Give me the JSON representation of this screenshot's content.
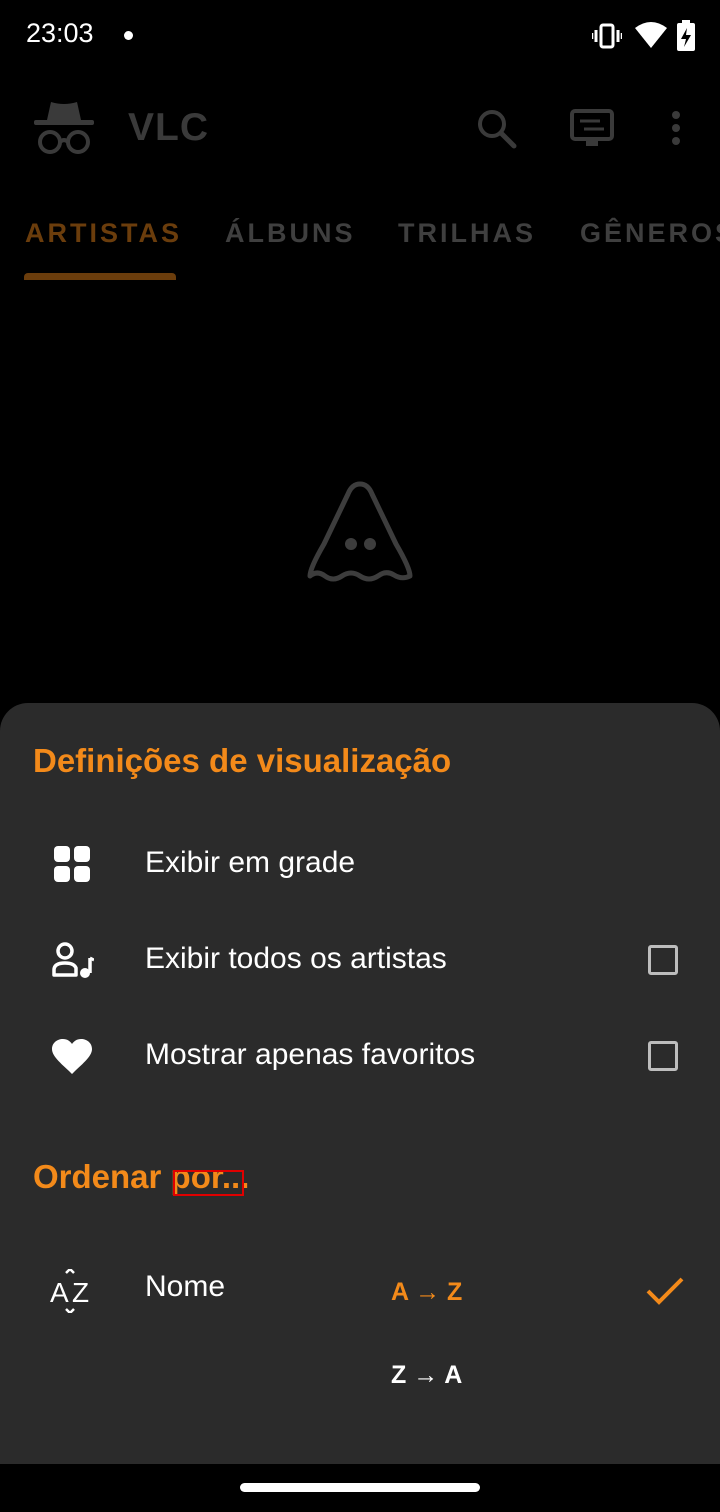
{
  "status_bar": {
    "time": "23:03",
    "icons": [
      "vibrate-icon",
      "wifi-icon",
      "battery-charging-icon"
    ]
  },
  "app_bar": {
    "title": "VLC",
    "icons": [
      "incognito-icon",
      "search-icon",
      "cast-icon",
      "more-vert-icon"
    ]
  },
  "tabs": [
    {
      "label": "ARTISTAS",
      "selected": true
    },
    {
      "label": "ÁLBUNS",
      "selected": false
    },
    {
      "label": "TRILHAS",
      "selected": false
    },
    {
      "label": "GÊNEROS",
      "selected": false
    }
  ],
  "empty_state": {
    "icon": "vlc-cone-icon"
  },
  "sheet": {
    "view_title": "Definições de visualização",
    "view_items": [
      {
        "label": "Exibir em grade",
        "icon": "grid-icon"
      },
      {
        "label": "Exibir todos os artistas",
        "icon": "artist-music-icon",
        "checked": false
      },
      {
        "label": "Mostrar apenas favoritos",
        "icon": "heart-icon",
        "checked": false
      }
    ],
    "sort_title": "Ordenar por...",
    "sort_items": [
      {
        "label": "Nome",
        "icon": "sort-alpha-icon",
        "asc_label": "A → Z",
        "desc_label": "Z → A",
        "selected": "asc"
      }
    ]
  },
  "colors": {
    "accent": "#f38a1a",
    "sheet_background": "#2b2b2b",
    "background": "#000000",
    "highlight_box": "#e00000"
  }
}
